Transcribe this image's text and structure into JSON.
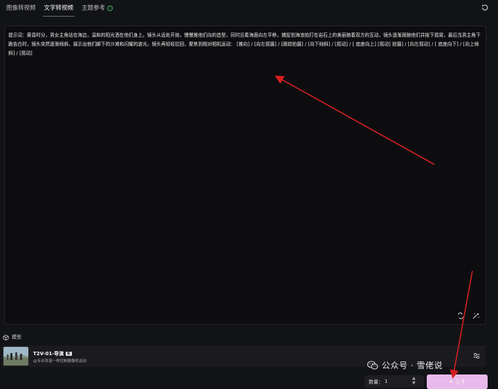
{
  "tabs": [
    {
      "label": "图像转视频"
    },
    {
      "label": "文字转视频"
    },
    {
      "label": "主题参考"
    }
  ],
  "prompt_text": "提示词：黄昏时分，男女主角站在海边，温和的阳光洒在他们身上。镜头从远处开始，慢慢推他们向的造型，同时沿着海面向左平移，捕捉到海浪拍打在岩石上的美丽随着双方的互动，镜头逐渐跟随他们并按下摇晃，最后当男主角下跪告白时，镜头突然逐渐倾斜，展示出他们脚下的沙滩和闪耀的波光，镜头再轻轻拉回，聚焦到相对相机运动： [推向] / [向左摇摄] / [跟踪拍摄] / [向下倾斜] / [摇动] / [ 底座向上] [摇动] 拍摄] / [向左摇动] / [ 底座向下] / [向上倾斜] / [摇动]",
  "model_section": {
    "title": "模型"
  },
  "model": {
    "name": "T2V-01-导演",
    "badge": "新",
    "desc": "@专业导演一样控制摄像机运动"
  },
  "watermark": {
    "text": "公众号 · 雪佬说"
  },
  "quantity": {
    "label": "数量：",
    "value": "1"
  },
  "generate": {
    "label": "三十"
  },
  "colors": {
    "accent": "#e8b9ea",
    "arrow": "#d42020",
    "info": "#43b36a"
  }
}
